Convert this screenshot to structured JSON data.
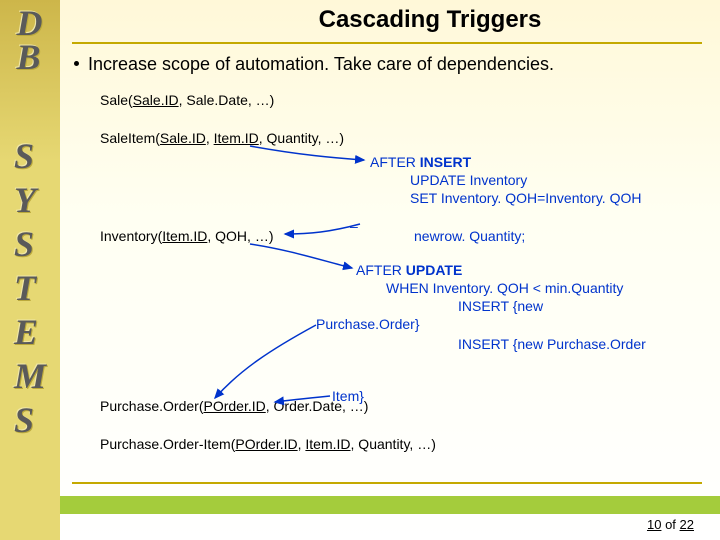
{
  "sidebar": {
    "db_d": "D",
    "db_b": "B",
    "s": "S",
    "y": "Y",
    "s2": "S",
    "t": "T",
    "e": "E",
    "m": "M",
    "s3": "S"
  },
  "title": "Cascading Triggers",
  "bullet": "Increase scope of automation. Take care of dependencies.",
  "l_sale_a": "Sale(",
  "l_sale_b": "Sale.ID",
  "l_sale_c": ", Sale.Date, …)",
  "l_si_a": "SaleItem(",
  "l_si_b": "Sale.ID",
  "l_si_c": ", ",
  "l_si_d": "Item.ID",
  "l_si_e": ", Quantity, …)",
  "l_inv_a": "Inventory(",
  "l_inv_b": "Item.ID",
  "l_inv_c": ", QOH, …)",
  "l_po_a": "Purchase.Order(",
  "l_po_b": "POrder.ID",
  "l_po_c": ", Order.Date, …)",
  "l_poi_a": "Purchase.Order-Item(",
  "l_poi_b": "POrder.ID",
  "l_poi_c": ", ",
  "l_poi_d": "Item.ID",
  "l_poi_e": ", Quantity, …)",
  "trg1_a": "AFTER ",
  "trg1_b": "INSERT",
  "trg1_c": "UPDATE Inventory",
  "trg1_d": "SET Inventory. QOH=Inventory. QOH",
  "dash": "–",
  "trg1_e": "newrow. Quantity;",
  "trg2_a": "AFTER ",
  "trg2_b": "UPDATE",
  "trg2_c": "WHEN Inventory. QOH < min.Quantity",
  "trg2_d": "INSERT {new",
  "trg2_e": "Purchase.Order}",
  "trg2_f": "INSERT {new Purchase.Order",
  "trg2_g": "Item}",
  "page": {
    "cur": "10",
    "of": " of ",
    "tot": "22"
  }
}
